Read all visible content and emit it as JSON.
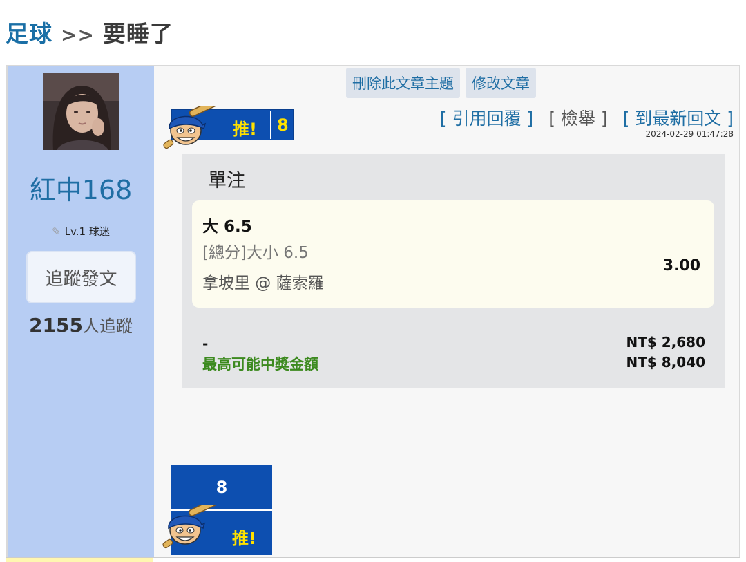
{
  "breadcrumb": {
    "sport": "足球",
    "separator": ">>",
    "title": "要睡了"
  },
  "author": {
    "username": "紅中168",
    "level": "Lv.1 球迷",
    "follow_button": "追蹤發文",
    "follower_count": "2155",
    "follower_label": "人追蹤"
  },
  "admin_actions": {
    "delete_label": "刪除此文章主題",
    "edit_label": "修改文章"
  },
  "push": {
    "label": "推!",
    "count": "8"
  },
  "post_actions": {
    "quote_label": "[ 引用回覆 ]",
    "report_label": "[ 檢舉 ]",
    "latest_label": "[ 到最新回文 ]",
    "timestamp": "2024-02-29 01:47:28"
  },
  "bet": {
    "type": "單注",
    "pick": "大 6.5",
    "market": "[總分]大小 6.5",
    "match": "拿坡里 @ 薩索羅",
    "odds": "3.00",
    "stake_label": "-",
    "stake_value": "NT$ 2,680",
    "payout_label": "最高可能中獎金額",
    "payout_value": "NT$ 8,040"
  },
  "colors": {
    "sidebar_bg": "#b7cdf3",
    "link_blue": "#1f6ea4",
    "push_blue": "#0d4fb0",
    "push_yellow": "#ffe100",
    "payout_green": "#3c8a1f"
  }
}
